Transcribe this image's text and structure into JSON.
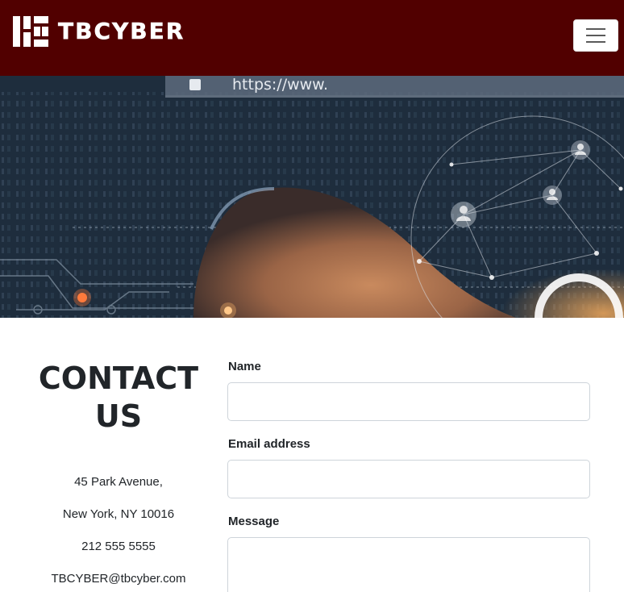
{
  "navbar": {
    "brand": "TBCYBER",
    "brand_color": "#510000",
    "toggle_icon": "hamburger-menu-icon"
  },
  "hero": {
    "url_text": "https://www."
  },
  "contact": {
    "heading_line1": "CONTACT",
    "heading_line2": "US",
    "address_line1": "45 Park Avenue,",
    "address_line2": "New York, NY 10016",
    "phone": "212 555 5555",
    "email": "TBCYBER@tbcyber.com"
  },
  "form": {
    "name_label": "Name",
    "name_value": "",
    "email_label": "Email address",
    "email_value": "",
    "message_label": "Message",
    "message_value": ""
  }
}
